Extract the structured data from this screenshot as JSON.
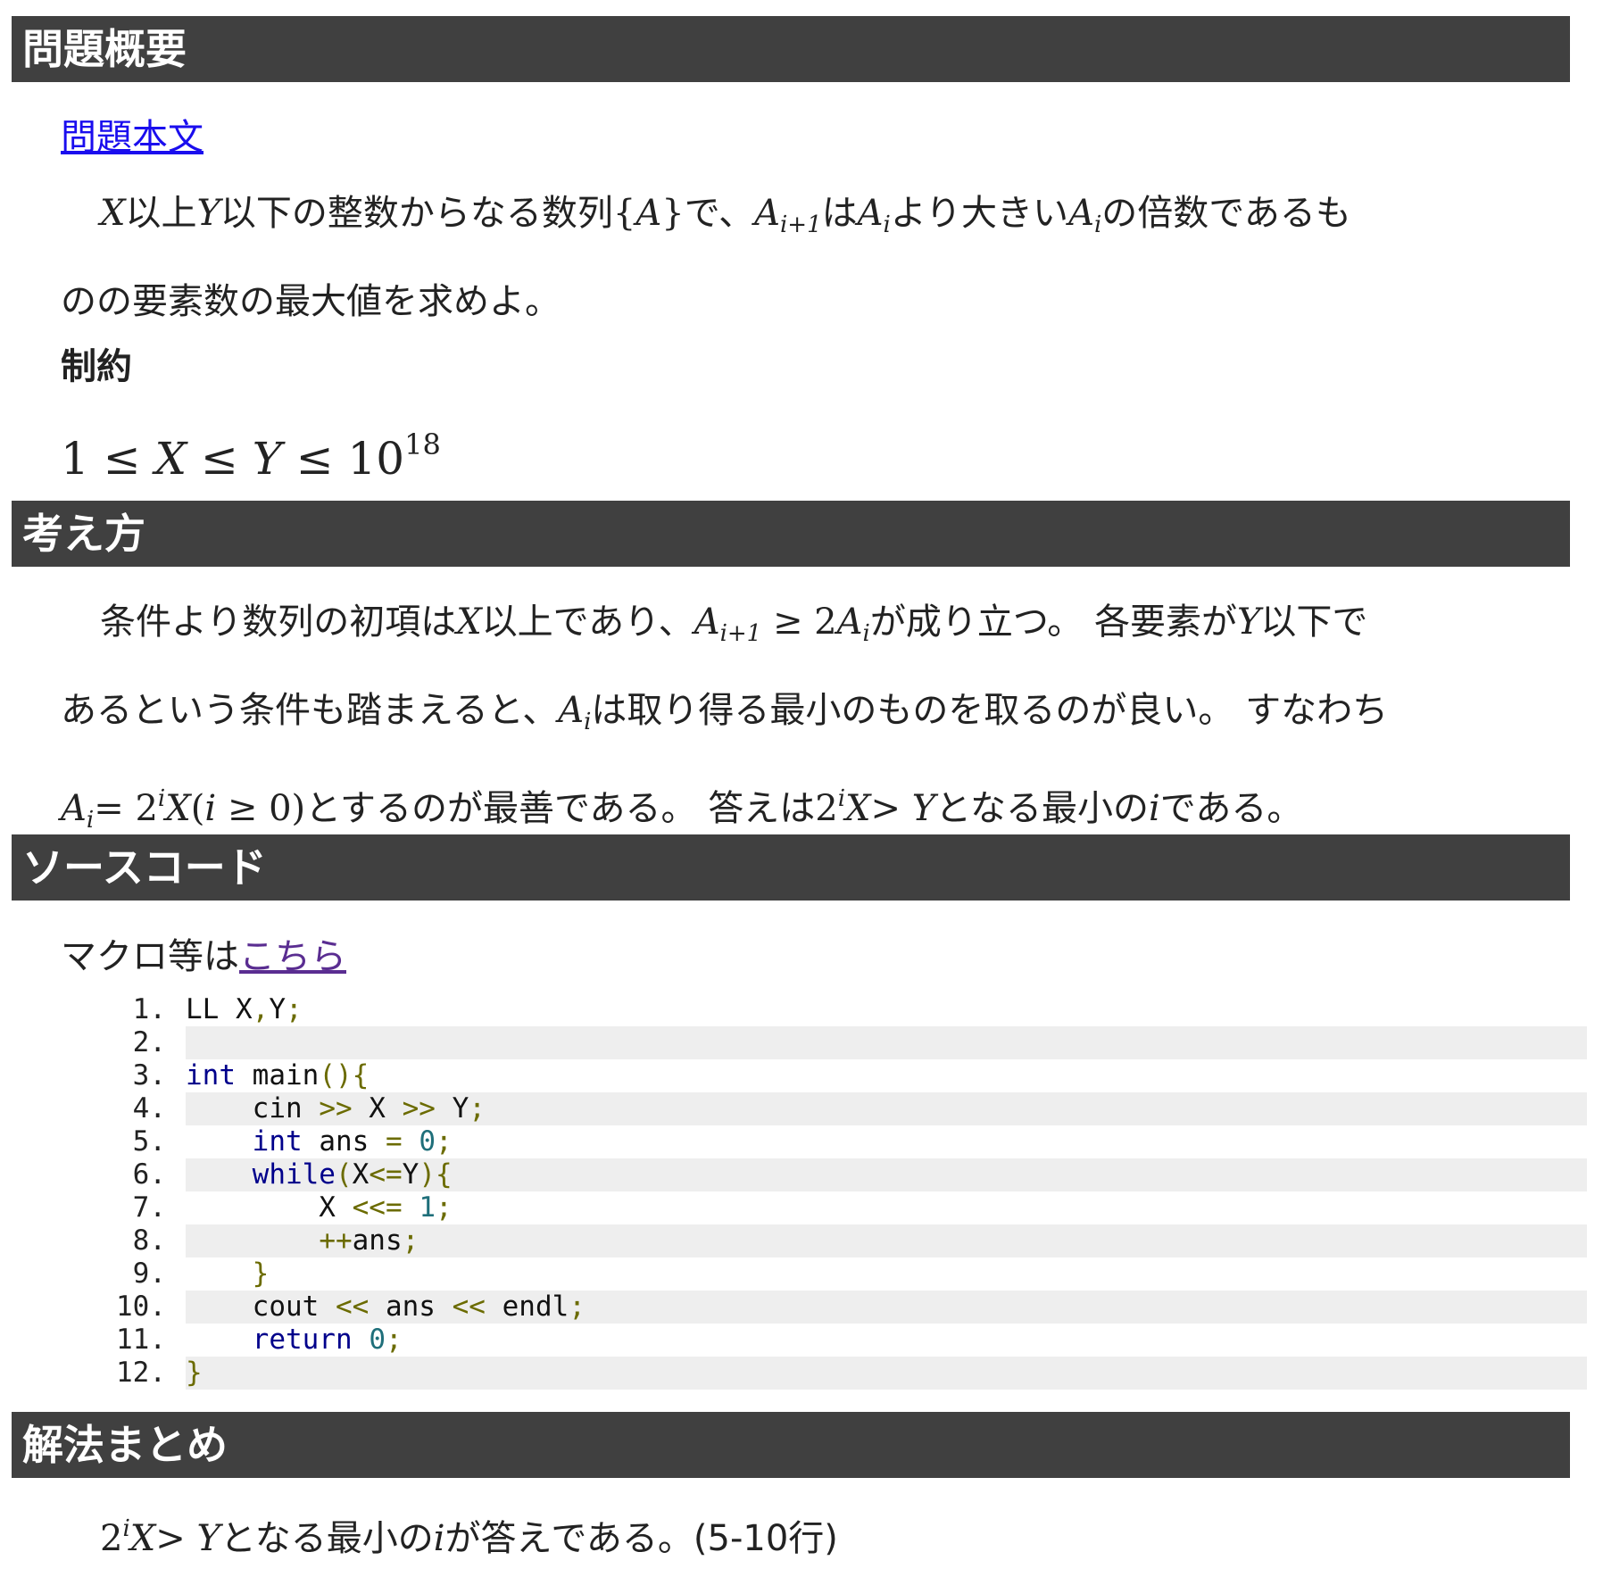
{
  "sections": {
    "overview_title": "問題概要",
    "approach_title": "考え方",
    "source_title": "ソースコード",
    "summary_title": "解法まとめ"
  },
  "overview": {
    "link_text": "問題本文",
    "text_a": "以上",
    "text_b": "以下の整数からなる数列",
    "text_c": "で、",
    "text_d": "は",
    "text_e": "より大きい",
    "text_f": "の倍数であるも",
    "text_g": "のの要素数の最大値を求めよ。",
    "constraints_label": "制約"
  },
  "approach": {
    "t1": "条件より数列の初項は",
    "t2": "以上であり、",
    "t3": "が成り立つ。 各要素が",
    "t4": "以下で",
    "t5": "あるという条件も踏まえると、",
    "t6": "は取り得る最小のものを取るのが良い。 すなわち",
    "t7": "とするのが最善である。 答えは",
    "t8": "となる最小の",
    "t9": "である。"
  },
  "source": {
    "macro_text": "マクロ等は",
    "macro_link": "こちら",
    "lines": [
      {
        "no": "1.",
        "code": "LL X,Y;"
      },
      {
        "no": "2.",
        "code": ""
      },
      {
        "no": "3.",
        "code": "int main(){"
      },
      {
        "no": "4.",
        "code": "    cin >> X >> Y;"
      },
      {
        "no": "5.",
        "code": "    int ans = 0;"
      },
      {
        "no": "6.",
        "code": "    while(X<=Y){"
      },
      {
        "no": "7.",
        "code": "        X <<= 1;"
      },
      {
        "no": "8.",
        "code": "        ++ans;"
      },
      {
        "no": "9.",
        "code": "    }"
      },
      {
        "no": "10.",
        "code": "    cout << ans << endl;"
      },
      {
        "no": "11.",
        "code": "    return 0;"
      },
      {
        "no": "12.",
        "code": "}"
      }
    ]
  },
  "summary": {
    "t1": "となる最小の",
    "t2": "が答えである。(5-10行)"
  }
}
